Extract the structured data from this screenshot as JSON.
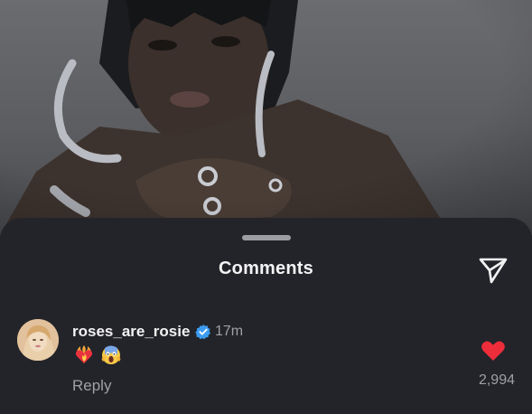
{
  "sheet": {
    "title": "Comments"
  },
  "comment": {
    "username": "roses_are_rosie",
    "verified": true,
    "timestamp": "17m",
    "emojis": [
      "heart-on-fire-emoji",
      "face-screaming-emoji"
    ],
    "reply_label": "Reply",
    "like_count": "2,994",
    "liked": true
  },
  "colors": {
    "sheet_background": "#232429",
    "like_red": "#ed2d3a",
    "verified_blue": "#3b9bf0",
    "muted_text": "#9fa0a6"
  },
  "icons": {
    "share": "paper-plane-icon",
    "verified": "verified-badge-icon",
    "like": "heart-icon"
  }
}
